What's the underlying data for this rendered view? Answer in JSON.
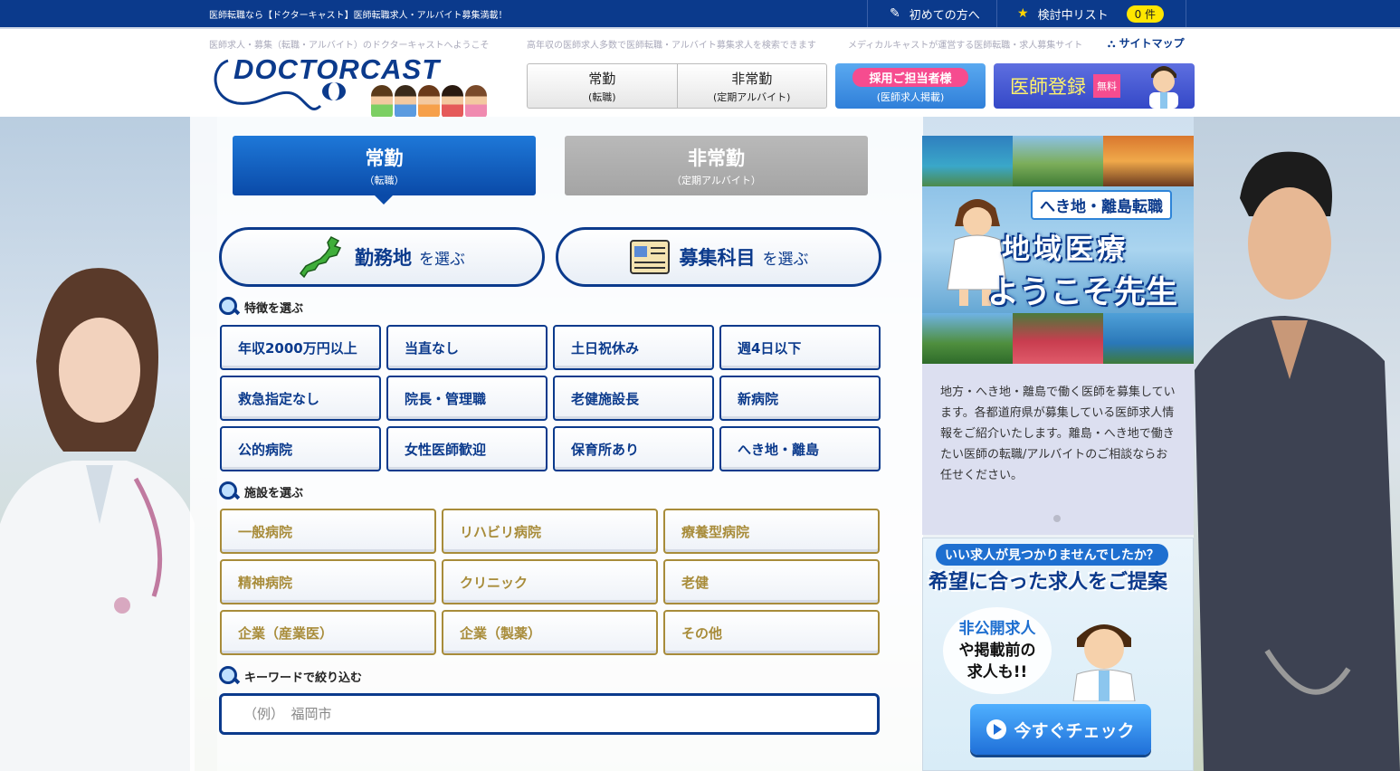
{
  "topbar": {
    "tagline": "医師転職なら【ドクターキャスト】医師転職求人・アルバイト募集満載！",
    "first_visit": "初めての方へ",
    "favorites": "検討中リスト",
    "favorites_count": "0 件"
  },
  "header": {
    "sub1": "医師求人・募集（転職・アルバイト）のドクターキャストへようこそ",
    "sub2": "高年収の医師求人多数で医師転職・アルバイト募集求人を検索できます",
    "sub3": "メディカルキャストが運営する医師転職・求人募集サイト",
    "sitemap": "サイトマップ",
    "logo": "DOCTORCAST",
    "nav_fulltime": "常勤",
    "nav_fulltime_sub": "(転職)",
    "nav_parttime": "非常勤",
    "nav_parttime_sub": "(定期アルバイト)",
    "recruit_label": "採用ご担当者様",
    "recruit_sub": "(医師求人掲載)",
    "register_label": "医師登録",
    "register_free": "無料"
  },
  "tabs": {
    "fulltime": "常勤",
    "fulltime_sub": "（転職）",
    "parttime": "非常勤",
    "parttime_sub": "（定期アルバイト）"
  },
  "selectors": {
    "area_main": "勤務地",
    "area_sub": "を選ぶ",
    "dept_main": "募集科目",
    "dept_sub": "を選ぶ"
  },
  "sections": {
    "features": "特徴を選ぶ",
    "facilities": "施設を選ぶ",
    "keyword": "キーワードで絞り込む"
  },
  "features": [
    "年収2000万円以上",
    "当直なし",
    "土日祝休み",
    "週4日以下",
    "救急指定なし",
    "院長・管理職",
    "老健施設長",
    "新病院",
    "公的病院",
    "女性医師歓迎",
    "保育所あり",
    "へき地・離島"
  ],
  "facilities": [
    "一般病院",
    "リハビリ病院",
    "療養型病院",
    "精神病院",
    "クリニック",
    "老健",
    "企業（産業医）",
    "企業（製薬）",
    "その他"
  ],
  "keyword": {
    "placeholder": "（例）　福岡市"
  },
  "banner1": {
    "badge": "へき地・離島転職",
    "title1": "地域医療",
    "title2": "ようこそ先生",
    "desc": "地方・へき地・離島で働く医師を募集しています。各都道府県が募集している医師求人情報をご紹介いたします。離島・へき地で働きたい医師の転職/アルバイトのご相談ならお任せください。"
  },
  "banner2": {
    "top": "いい求人が見つかりませんでしたか？",
    "head": "希望に合った求人をご提案",
    "bubble1": "非公開求人",
    "bubble2": "や掲載前の",
    "bubble3": "求人も!!",
    "button": "今すぐチェック"
  },
  "colors": {
    "brand": "#0b3a8c",
    "accent": "#f64c8f",
    "gold": "#a88c3a"
  }
}
